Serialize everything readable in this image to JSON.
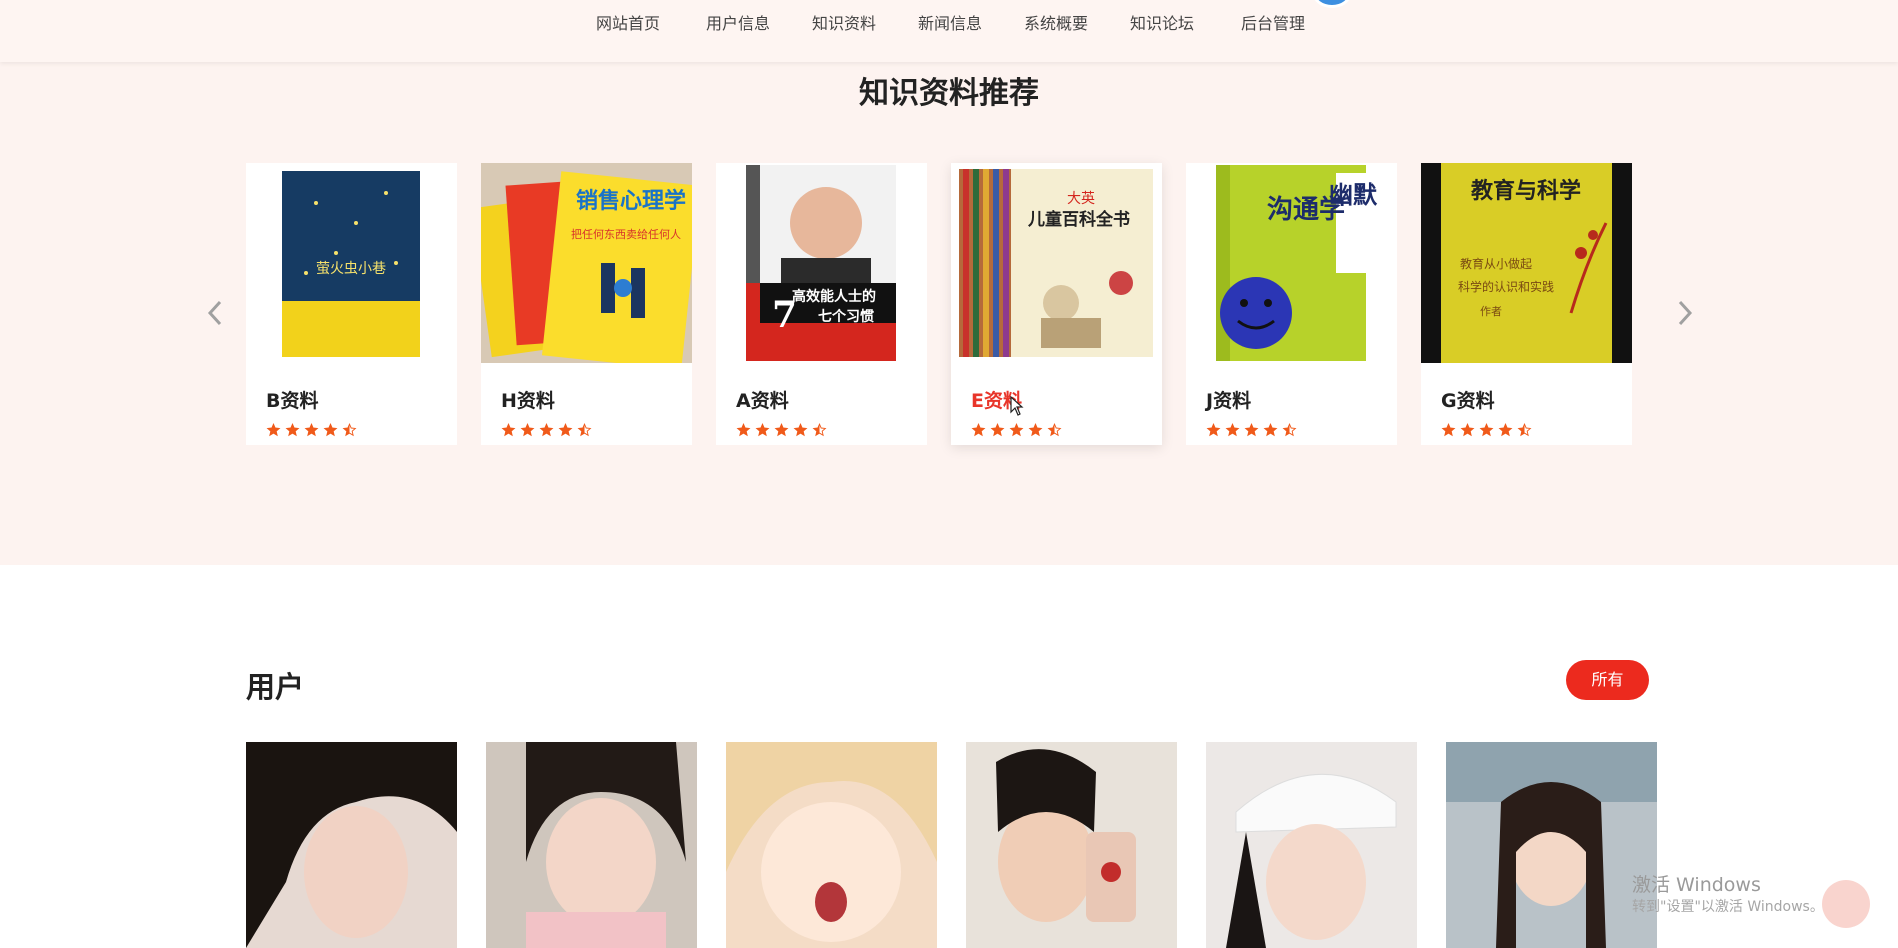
{
  "nav": {
    "items": [
      "网站首页",
      "用户信息",
      "知识资料",
      "新闻信息",
      "系统概要",
      "知识论坛",
      "后台管理"
    ]
  },
  "recommend": {
    "title": "知识资料推荐",
    "books": [
      {
        "name": "B资料",
        "rating": 4.5,
        "cover_text": "萤火虫小巷"
      },
      {
        "name": "H资料",
        "rating": 4.5,
        "cover_text": "销售心理学",
        "cover_sub": "把任何东西卖给任何人"
      },
      {
        "name": "A资料",
        "rating": 4.5,
        "cover_text": "高效能人士的",
        "cover_sub": "七个习惯"
      },
      {
        "name": "E资料",
        "rating": 4.5,
        "cover_text": "儿童百科全书",
        "cover_top": "大英"
      },
      {
        "name": "J资料",
        "rating": 4.5,
        "cover_text": "沟通学",
        "cover_top": "幽默"
      },
      {
        "name": "G资料",
        "rating": 4.5,
        "cover_text": "教育与科学",
        "cover_sub": "教育从小做起",
        "cover_sub2": "科学的认识和实践",
        "cover_sub3": "作者"
      }
    ],
    "active_index": 3
  },
  "users": {
    "title": "用户",
    "all_label": "所有",
    "photo_count": 6
  },
  "watermark": {
    "line1": "激活 Windows",
    "line2": "转到\"设置\"以激活 Windows。"
  },
  "colors": {
    "accent": "#ec2a1e",
    "star": "#f05a1a",
    "section_bg": "#fdf3f0"
  }
}
